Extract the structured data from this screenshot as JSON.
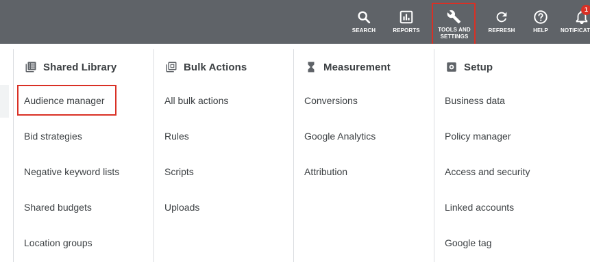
{
  "toolbar": {
    "items": [
      {
        "label": "SEARCH",
        "icon": "search-icon"
      },
      {
        "label": "REPORTS",
        "icon": "reports-icon"
      },
      {
        "label": "TOOLS AND\nSETTINGS",
        "icon": "wrench-icon"
      },
      {
        "label": "REFRESH",
        "icon": "refresh-icon"
      },
      {
        "label": "HELP",
        "icon": "help-icon"
      },
      {
        "label": "NOTIFICATIONS",
        "icon": "bell-icon"
      }
    ],
    "notification_count": "1"
  },
  "menu": {
    "columns": [
      {
        "title": "Shared Library",
        "icon": "library-icon",
        "items": [
          "Audience manager",
          "Bid strategies",
          "Negative keyword lists",
          "Shared budgets",
          "Location groups"
        ]
      },
      {
        "title": "Bulk Actions",
        "icon": "bulk-actions-icon",
        "items": [
          "All bulk actions",
          "Rules",
          "Scripts",
          "Uploads"
        ]
      },
      {
        "title": "Measurement",
        "icon": "hourglass-icon",
        "items": [
          "Conversions",
          "Google Analytics",
          "Attribution"
        ]
      },
      {
        "title": "Setup",
        "icon": "setup-icon",
        "items": [
          "Business data",
          "Policy manager",
          "Access and security",
          "Linked accounts",
          "Google tag"
        ]
      }
    ]
  },
  "colors": {
    "topbar": "#5f6368",
    "highlight": "#d93025",
    "text": "#3c4043",
    "divider": "#dadce0"
  }
}
